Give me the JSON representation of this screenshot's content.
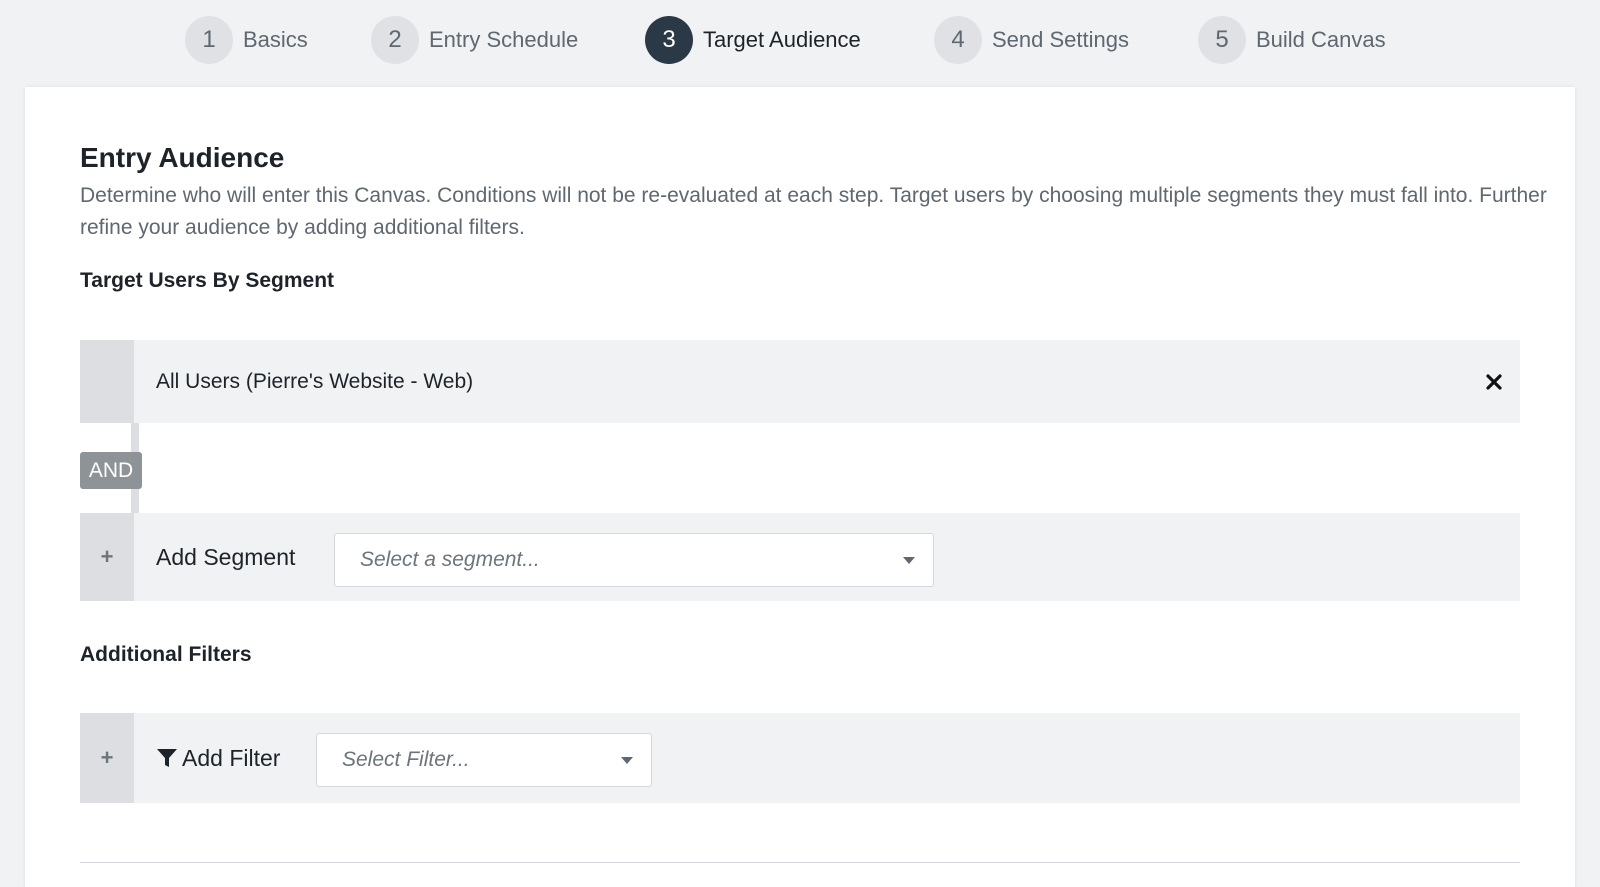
{
  "steps": [
    {
      "num": "1",
      "label": "Basics",
      "active": false
    },
    {
      "num": "2",
      "label": "Entry Schedule",
      "active": false
    },
    {
      "num": "3",
      "label": "Target Audience",
      "active": true
    },
    {
      "num": "4",
      "label": "Send Settings",
      "active": false
    },
    {
      "num": "5",
      "label": "Build Canvas",
      "active": false
    }
  ],
  "audience": {
    "title": "Entry Audience",
    "description": "Determine who will enter this Canvas. Conditions will not be re-evaluated at each step. Target users by choosing multiple segments they must fall into. Further refine your audience by adding additional filters."
  },
  "segments": {
    "title": "Target Users By Segment",
    "selected": "All Users (Pierre's Website - Web)",
    "and_label": "AND",
    "add_label": "Add Segment",
    "add_icon": "+",
    "select_placeholder": "Select a segment..."
  },
  "filters": {
    "title": "Additional Filters",
    "add_label": "Add Filter",
    "add_icon": "+",
    "select_placeholder": "Select Filter..."
  },
  "colors": {
    "active_step": "#2b3947",
    "inactive_step": "#dfe1e4",
    "and_badge": "#8e9398",
    "row_background": "#f1f2f4"
  }
}
